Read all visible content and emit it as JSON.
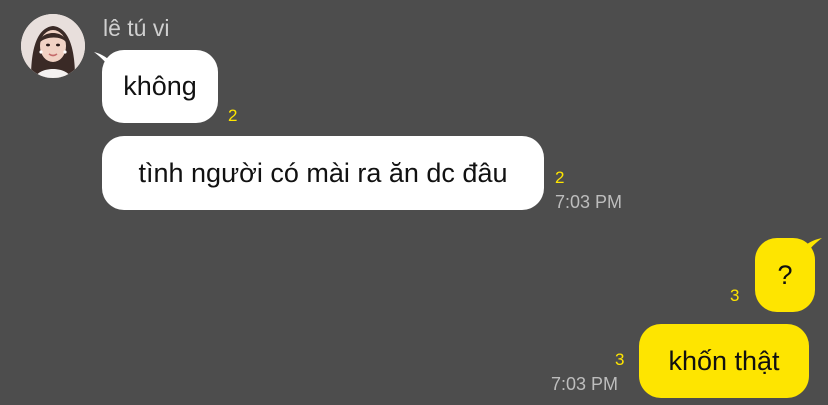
{
  "conversation": {
    "sender_name": "lê tú vi",
    "messages": [
      {
        "direction": "incoming",
        "text": "không",
        "unread_count": "2"
      },
      {
        "direction": "incoming",
        "text": "tình người có mài ra ăn dc đâu",
        "unread_count": "2",
        "time": "7:03 PM"
      },
      {
        "direction": "outgoing",
        "text": "?",
        "unread_count": "3"
      },
      {
        "direction": "outgoing",
        "text": "khốn thật",
        "unread_count": "3",
        "time": "7:03 PM"
      }
    ]
  },
  "colors": {
    "background": "#4d4d4d",
    "incoming_bubble": "#ffffff",
    "outgoing_bubble": "#fee500",
    "unread_count": "#fee500",
    "timestamp": "#bdbdbd",
    "sender_name": "#cfcfcf"
  }
}
